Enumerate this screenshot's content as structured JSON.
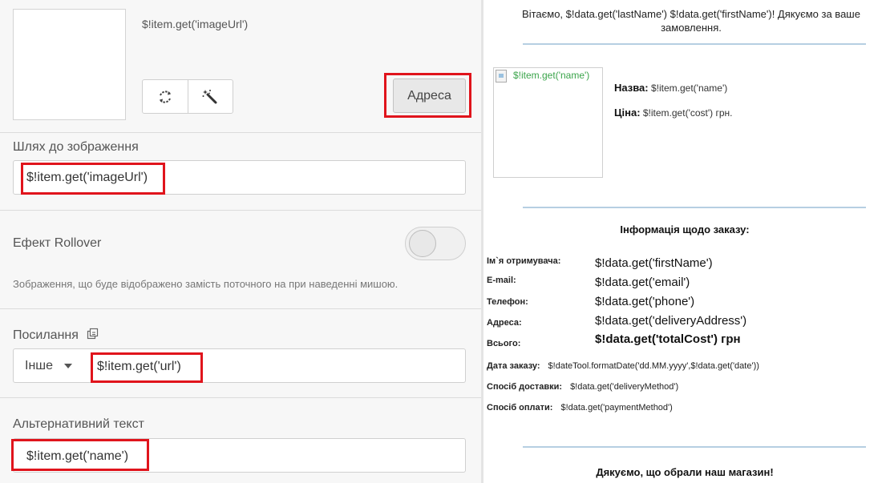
{
  "settings": {
    "image_url_text": "$!item.get('imageUrl')",
    "address_button": "Адреса",
    "image_path": {
      "label": "Шлях до зображення",
      "value": "$!item.get('imageUrl')"
    },
    "rollover": {
      "label": "Ефект Rollover",
      "hint": "Зображення, що буде відображено замість поточного на при наведенні мишою."
    },
    "link": {
      "label": "Посилання",
      "type_selected": "Інше",
      "value": "$!item.get('url')"
    },
    "alt_text": {
      "label": "Альтернативний текст",
      "value": "$!item.get('name')"
    },
    "highlight_color": "#e0141c"
  },
  "email": {
    "greeting": "Вітаємо, $!data.get('lastName') $!data.get('firstName')! Дякуємо за ваше замовлення.",
    "product": {
      "image_alt": "$!item.get('name')",
      "name_label": "Назва:",
      "name_value": "$!item.get('name')",
      "price_label": "Ціна:",
      "price_value": "$!item.get('cost') грн."
    },
    "order_title": "Інформація щодо заказу:",
    "order_rows": [
      {
        "label": "Ім`я отримувача:",
        "value": "$!data.get('firstName')"
      },
      {
        "label": "E-mail:",
        "value": "$!data.get('email')"
      },
      {
        "label": "Телефон:",
        "value": "$!data.get('phone')"
      },
      {
        "label": "Адреса:",
        "value": "$!data.get('deliveryAddress')"
      },
      {
        "label": "Всього:",
        "value": "$!data.get('totalCost') грн"
      }
    ],
    "extra_rows": [
      {
        "label": "Дата заказу:",
        "value": "$!dateTool.formatDate('dd.MM.yyyy',$!data.get('date'))"
      },
      {
        "label": "Спосіб доставки:",
        "value": "$!data.get('deliveryMethod')"
      },
      {
        "label": "Спосіб оплати:",
        "value": "$!data.get('paymentMethod')"
      }
    ],
    "thanks": "Дякуємо, що обрали наш магазин!"
  }
}
